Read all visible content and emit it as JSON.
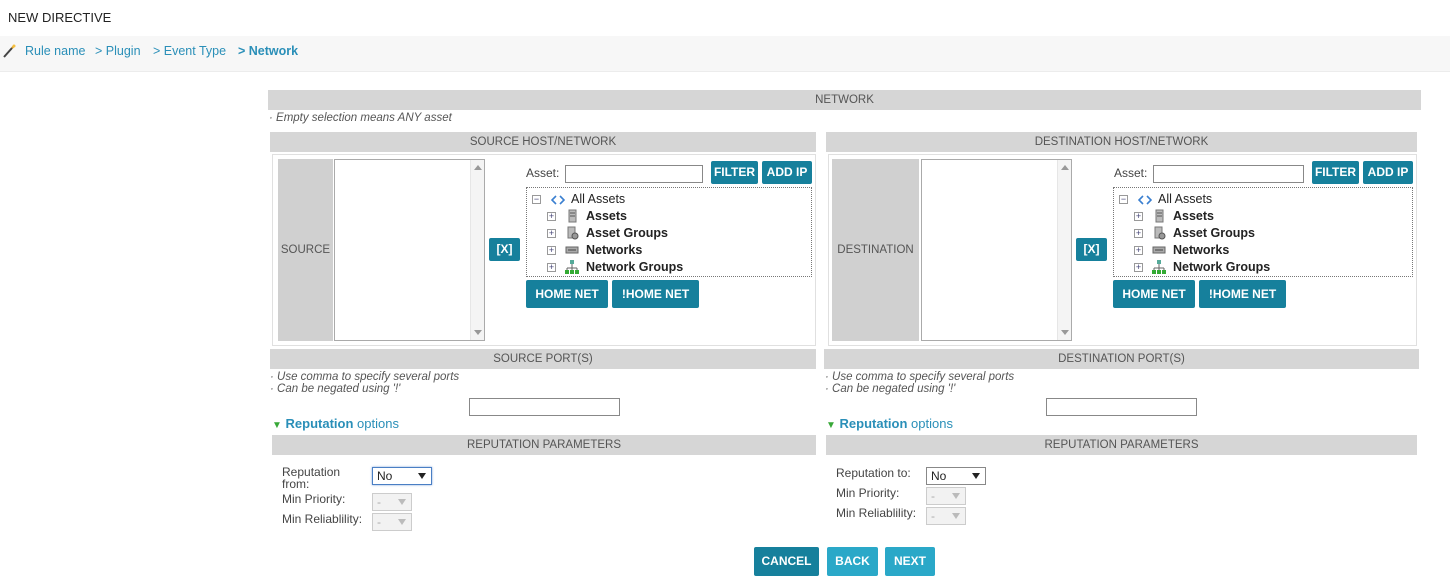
{
  "header": {
    "title": "NEW DIRECTIVE"
  },
  "breadcrumb": [
    {
      "label": "Rule name"
    },
    {
      "label": "> Plugin"
    },
    {
      "label": "> Event Type"
    },
    {
      "label": "> Network"
    }
  ],
  "network": {
    "title": "NETWORK",
    "note": "· Empty selection means ANY asset"
  },
  "source": {
    "header": "SOURCE HOST/NETWORK",
    "side_label": "SOURCE",
    "clear_label": "[X]",
    "asset_label": "Asset:",
    "asset_value": "",
    "filter_label": "FILTER",
    "add_ip_label": "ADD IP",
    "tree": {
      "root": "All Assets",
      "children": [
        "Assets",
        "Asset Groups",
        "Networks",
        "Network Groups"
      ]
    },
    "home_net_label": "HOME NET",
    "not_home_net_label": "!HOME NET",
    "ports_header": "SOURCE PORT(S)",
    "ports_note1": "· Use comma to specify several ports",
    "ports_note2": "· Can be negated using '!'",
    "ports_value": "",
    "rep_link_bold": "Reputation",
    "rep_link_rest": " options",
    "rep_header": "REPUTATION PARAMETERS",
    "rep_from_label": "Reputation from:",
    "rep_from_value": "No",
    "min_priority_label": "Min Priority:",
    "min_priority_value": "-",
    "min_reliability_label": "Min Reliablility:",
    "min_reliability_value": "-"
  },
  "destination": {
    "header": "DESTINATION HOST/NETWORK",
    "side_label": "DESTINATION",
    "clear_label": "[X]",
    "asset_label": "Asset:",
    "asset_value": "",
    "filter_label": "FILTER",
    "add_ip_label": "ADD IP",
    "tree": {
      "root": "All Assets",
      "children": [
        "Assets",
        "Asset Groups",
        "Networks",
        "Network Groups"
      ]
    },
    "home_net_label": "HOME NET",
    "not_home_net_label": "!HOME NET",
    "ports_header": "DESTINATION PORT(S)",
    "ports_note1": "· Use comma to specify several ports",
    "ports_note2": "· Can be negated using '!'",
    "ports_value": "",
    "rep_link_bold": "Reputation",
    "rep_link_rest": " options",
    "rep_header": "REPUTATION PARAMETERS",
    "rep_to_label": "Reputation to:",
    "rep_to_value": "No",
    "min_priority_label": "Min Priority:",
    "min_priority_value": "-",
    "min_reliability_label": "Min Reliablility:",
    "min_reliability_value": "-"
  },
  "footer": {
    "cancel_label": "CANCEL",
    "back_label": "BACK",
    "next_label": "NEXT"
  },
  "colors": {
    "primary_button": "#16809c",
    "secondary_button": "#2aa8c8",
    "link": "#2a8fb8",
    "section_header": "#d6d6d6"
  }
}
